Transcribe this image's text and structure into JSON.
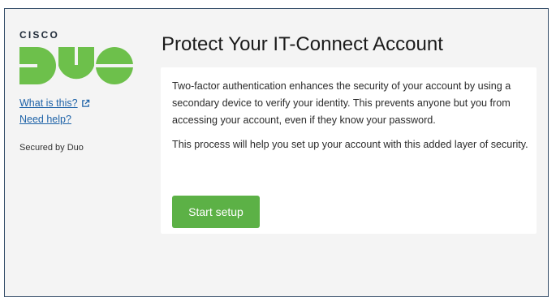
{
  "sidebar": {
    "brand_text": "CISCO",
    "logo_text": "DUO",
    "what_is_this": "What is this?",
    "need_help": "Need help?",
    "secured_by": "Secured by Duo"
  },
  "main": {
    "title": "Protect Your IT-Connect Account",
    "paragraph_1": "Two-factor authentication enhances the security of your account by using a secondary device to verify your identity. This prevents anyone but you from accessing your account, even if they know your password.",
    "paragraph_2": "This process will help you set up your account with this added layer of security.",
    "start_button": "Start setup"
  },
  "colors": {
    "duo_green": "#6dc04b",
    "button_green": "#5cb146",
    "link_blue": "#1f63a8",
    "frame_border": "#37506b",
    "background": "#f4f4f4"
  },
  "icons": {
    "external_link": "external-link-icon"
  }
}
